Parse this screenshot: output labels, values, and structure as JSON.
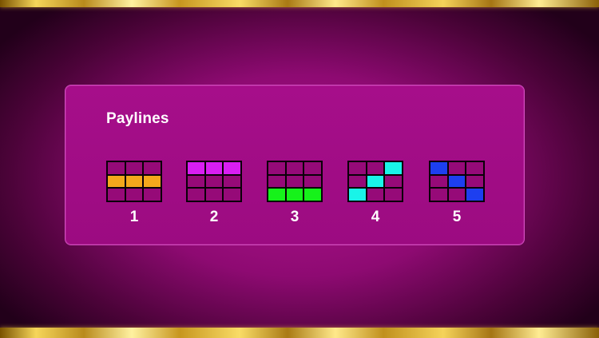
{
  "paytable": {
    "title": "Paylines",
    "paylines": [
      {
        "number": "1",
        "color": "#f4a81c",
        "highlight": [
          [
            1,
            0
          ],
          [
            1,
            1
          ],
          [
            1,
            2
          ]
        ]
      },
      {
        "number": "2",
        "color": "#d91ef2",
        "highlight": [
          [
            0,
            0
          ],
          [
            0,
            1
          ],
          [
            0,
            2
          ]
        ]
      },
      {
        "number": "3",
        "color": "#16f21a",
        "highlight": [
          [
            2,
            0
          ],
          [
            2,
            1
          ],
          [
            2,
            2
          ]
        ]
      },
      {
        "number": "4",
        "color": "#19f4e8",
        "highlight": [
          [
            2,
            0
          ],
          [
            1,
            1
          ],
          [
            0,
            2
          ]
        ]
      },
      {
        "number": "5",
        "color": "#1d3ff0",
        "highlight": [
          [
            0,
            0
          ],
          [
            1,
            1
          ],
          [
            2,
            2
          ]
        ]
      }
    ]
  },
  "theme": {
    "cell_color": "#960a78",
    "panel_color": "#a60e8a",
    "frame_color": "#f6d65a"
  }
}
